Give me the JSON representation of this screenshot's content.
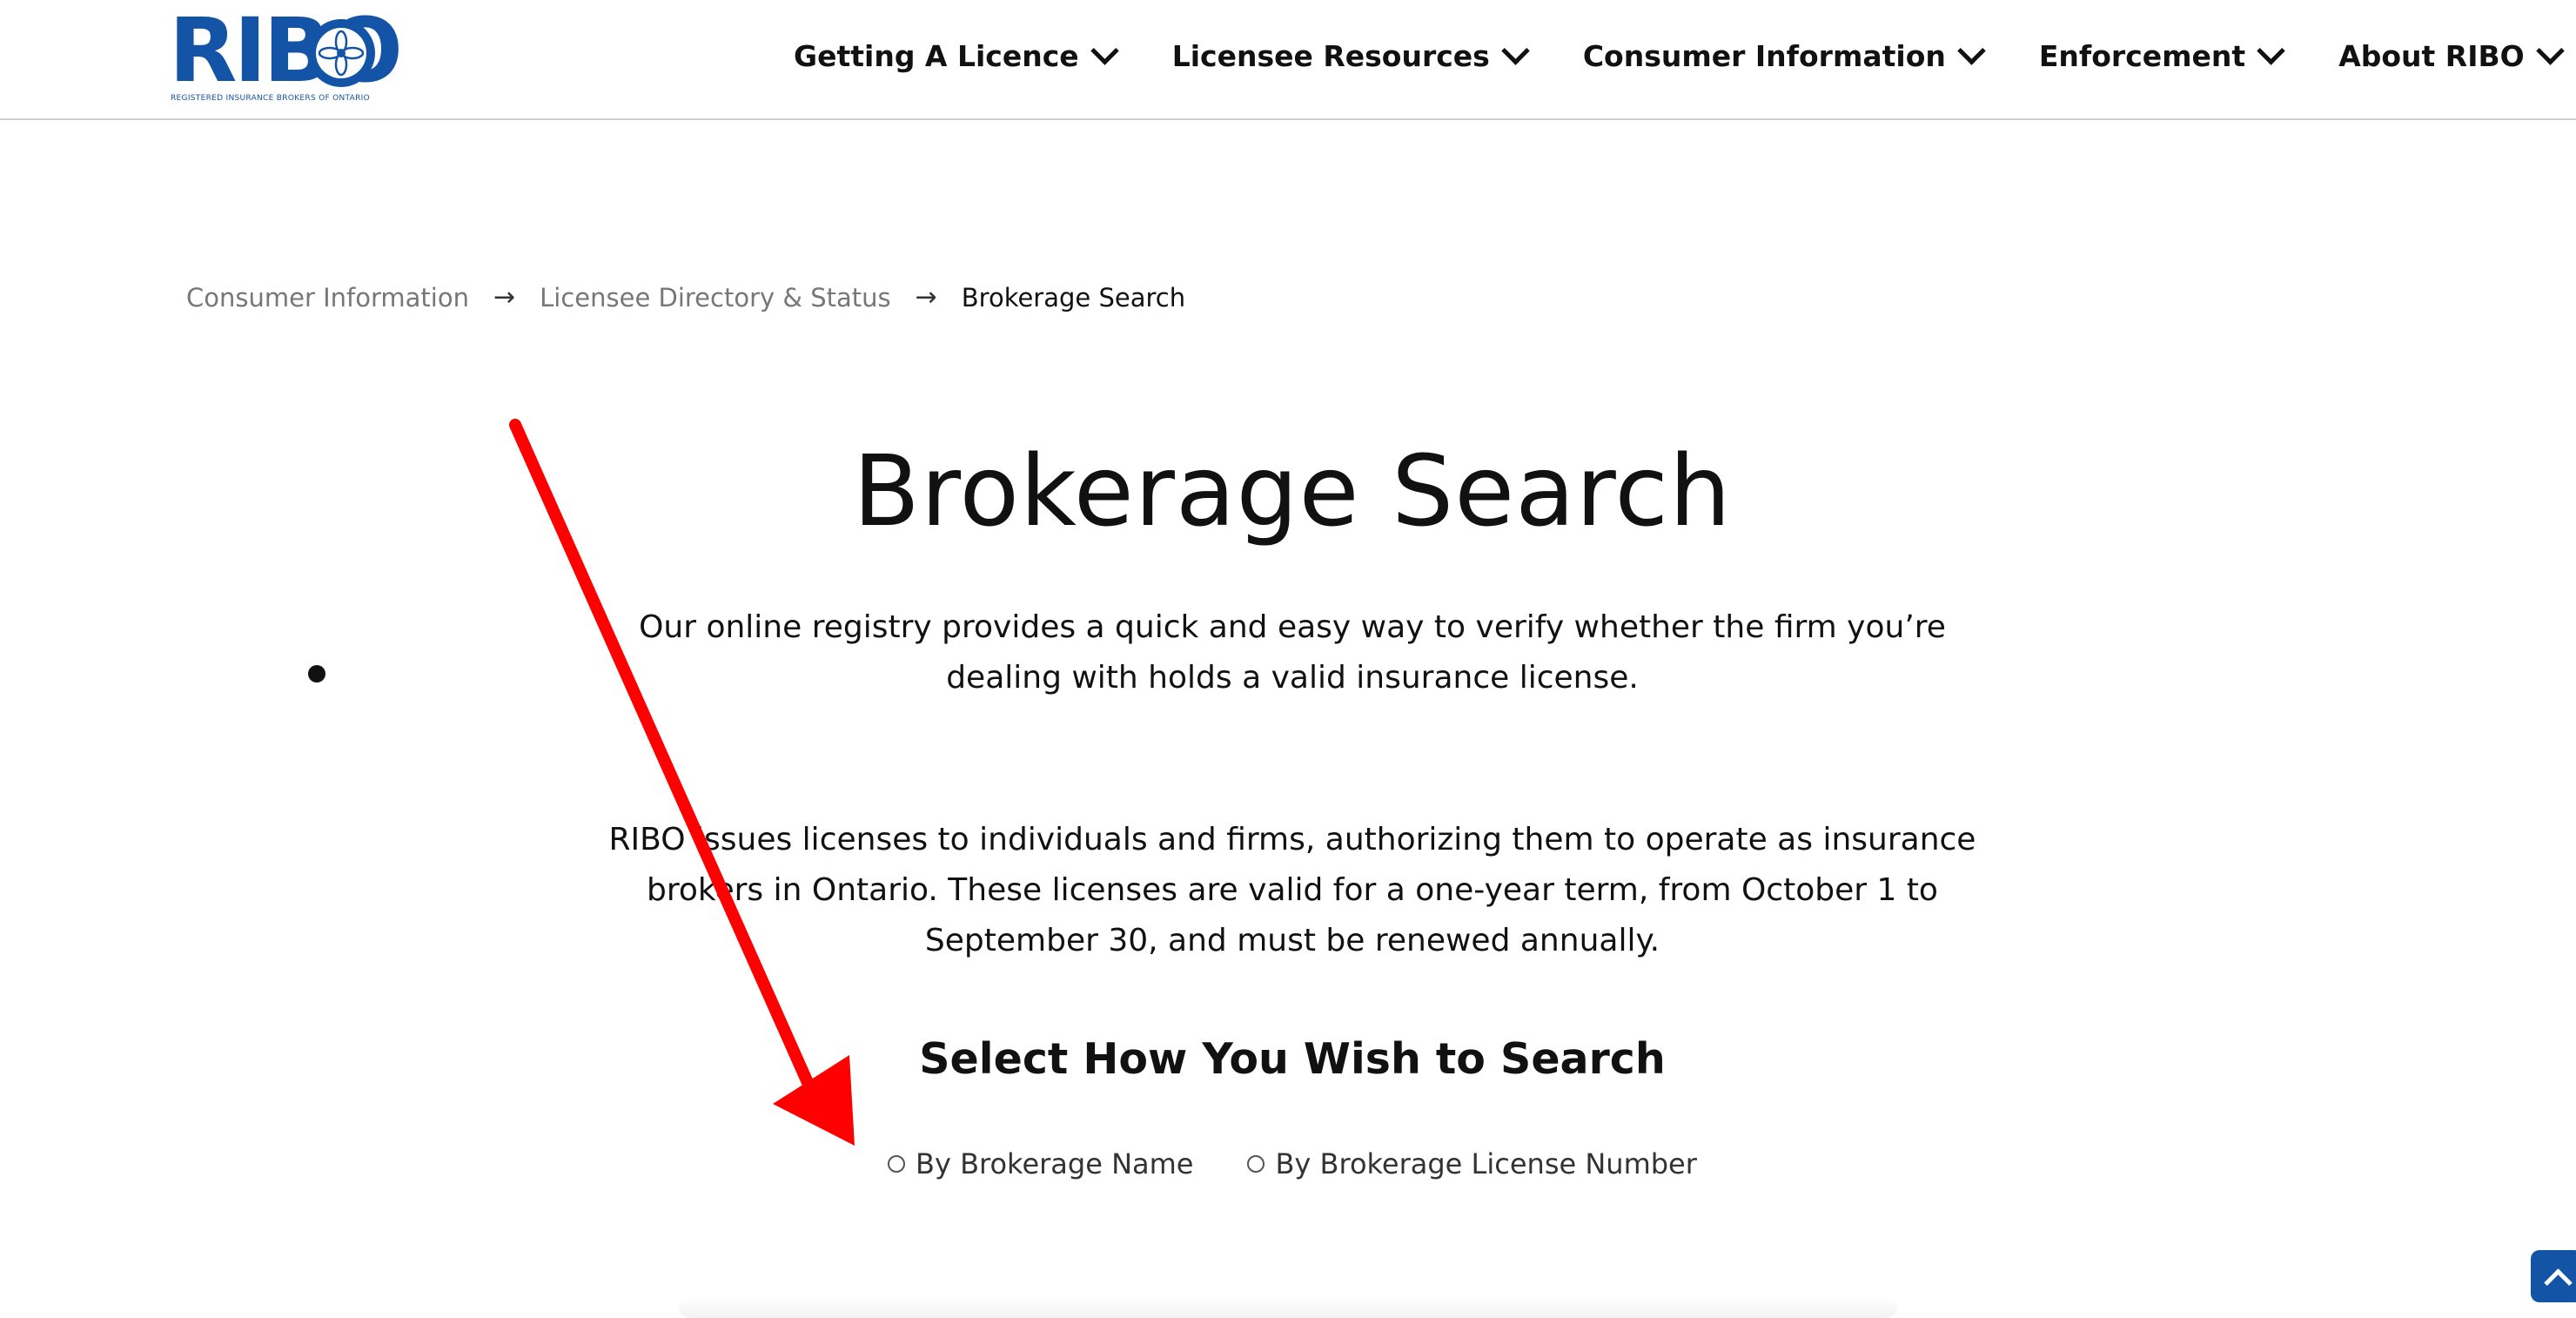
{
  "header": {
    "logo_text": "RIBO",
    "logo_subtitle": "REGISTERED INSURANCE BROKERS OF ONTARIO",
    "nav": [
      {
        "label": "Getting A Licence"
      },
      {
        "label": "Licensee Resources"
      },
      {
        "label": "Consumer Information"
      },
      {
        "label": "Enforcement"
      },
      {
        "label": "About RIBO"
      }
    ]
  },
  "breadcrumb": {
    "items": [
      "Consumer Information",
      "Licensee Directory & Status"
    ],
    "current": "Brokerage Search",
    "separator": "→"
  },
  "main": {
    "title": "Brokerage Search",
    "paragraph1": "Our online registry provides a quick and easy way to verify whether the firm you’re dealing with holds a valid insurance license.",
    "paragraph2": "RIBO issues licenses to individuals and firms, authorizing them to operate as insurance brokers in Ontario. These licenses are valid for a one-year term, from October 1 to September 30, and must be renewed annually.",
    "search_heading": "Select How You Wish to Search",
    "search_options": [
      {
        "label": "By Brokerage Name",
        "selected": false
      },
      {
        "label": "By Brokerage License Number",
        "selected": false
      }
    ]
  },
  "colors": {
    "brand_blue": "#1454a6",
    "annotation_red": "#ff0000"
  },
  "icons": {
    "nav_dropdown": "chevron-down-icon",
    "scroll_top": "chevron-up-icon"
  }
}
